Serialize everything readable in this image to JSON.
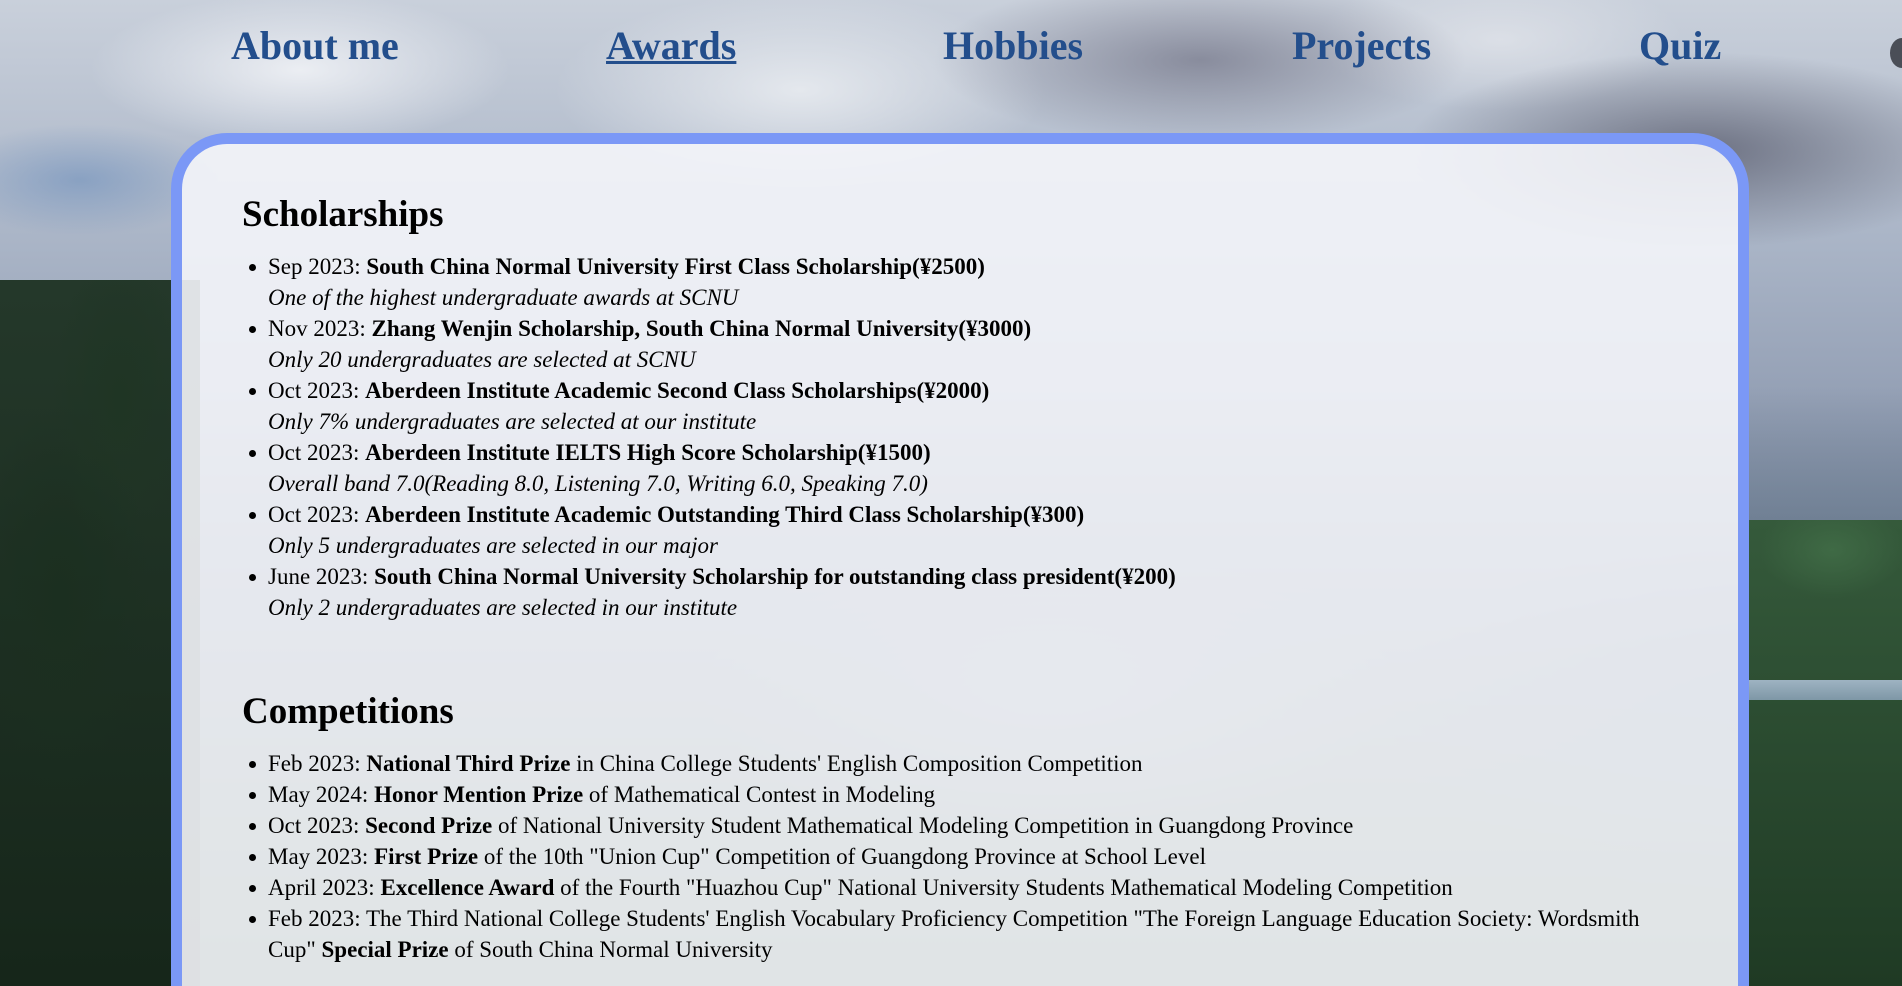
{
  "nav": {
    "items": [
      "About me",
      "Awards",
      "Hobbies",
      "Projects",
      "Quiz"
    ],
    "active": "Awards"
  },
  "colors": {
    "nav_text": "#234e8c",
    "card_border": "#7b98f6",
    "card_bg": "#f4f5fa"
  },
  "scholarships": {
    "heading": "Scholarships",
    "items": [
      {
        "date": "Sep 2023:",
        "title": "South China Normal University First Class Scholarship(¥2500)",
        "desc": "One of the highest undergraduate awards at SCNU"
      },
      {
        "date": "Nov 2023:",
        "title": "Zhang Wenjin Scholarship, South China Normal University(¥3000)",
        "desc": "Only 20 undergraduates are selected at SCNU"
      },
      {
        "date": "Oct 2023:",
        "title": "Aberdeen Institute Academic Second Class Scholarships(¥2000)",
        "desc": "Only 7% undergraduates are selected at our institute"
      },
      {
        "date": "Oct 2023:",
        "title": "Aberdeen Institute IELTS High Score Scholarship(¥1500)",
        "desc": "Overall band 7.0(Reading 8.0, Listening 7.0, Writing 6.0, Speaking 7.0)"
      },
      {
        "date": "Oct 2023:",
        "title": "Aberdeen Institute Academic Outstanding Third Class Scholarship(¥300)",
        "desc": "Only 5 undergraduates are selected in our major"
      },
      {
        "date": "June 2023:",
        "title": "South China Normal University Scholarship for outstanding class president(¥200)",
        "desc": "Only 2 undergraduates are selected in our institute"
      }
    ]
  },
  "competitions": {
    "heading": "Competitions",
    "items": [
      {
        "date": "Feb 2023:",
        "prize": "National Third Prize",
        "rest": "in China College Students' English Composition Competition"
      },
      {
        "date": "May 2024:",
        "prize": "Honor Mention Prize",
        "rest": "of Mathematical Contest in Modeling"
      },
      {
        "date": "Oct 2023:",
        "prize": "Second Prize",
        "rest": "of National University Student Mathematical Modeling Competition in Guangdong Province"
      },
      {
        "date": "May 2023:",
        "prize": "First Prize",
        "rest": "of the 10th \"Union Cup\" Competition of Guangdong Province at School Level"
      },
      {
        "date": "April 2023:",
        "prize": "Excellence Award",
        "rest": "of the Fourth \"Huazhou Cup\" National University Students Mathematical Modeling Competition"
      },
      {
        "date": "Feb 2023:",
        "pre": "The Third National College Students' English Vocabulary Proficiency Competition \"The Foreign Language Education Society: Wordsmith Cup\"",
        "prize": "Special Prize",
        "rest": "of South China Normal University"
      }
    ]
  }
}
